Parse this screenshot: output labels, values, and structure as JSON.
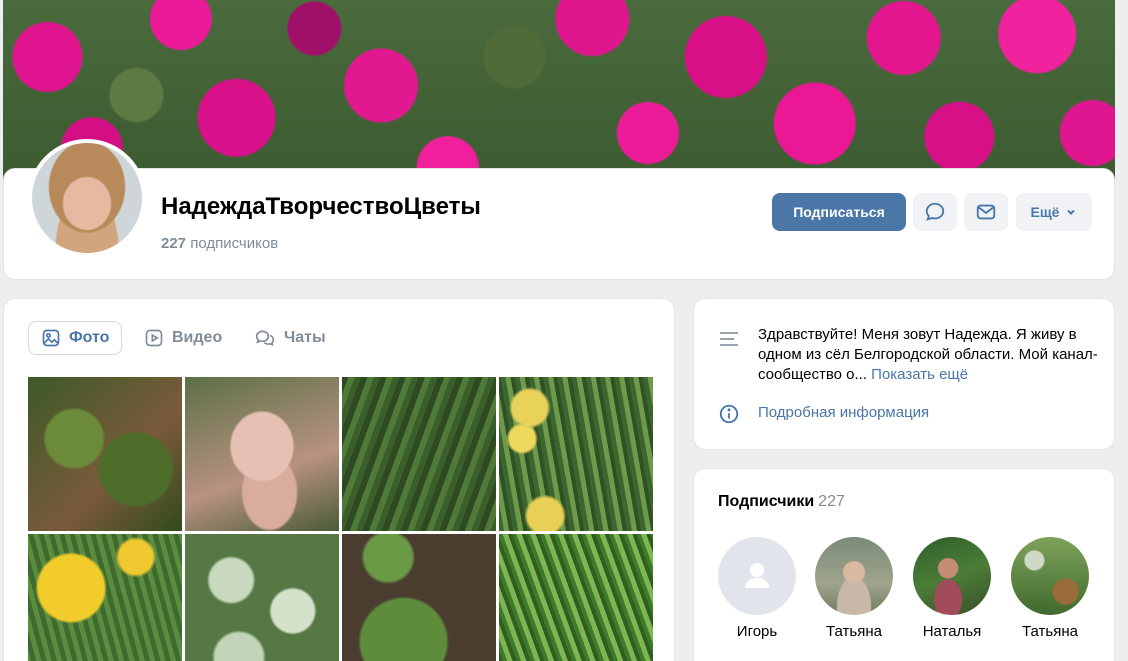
{
  "header": {
    "page_name": "НадеждаТворчествоЦветы",
    "subscribers_count": "227",
    "subscribers_label": "подписчиков",
    "subscribe_button": "Подписаться",
    "more_button": "Ещё"
  },
  "tabs": [
    {
      "label": "Фото",
      "icon": "photo-icon",
      "active": true
    },
    {
      "label": "Видео",
      "icon": "video-icon",
      "active": false
    },
    {
      "label": "Чаты",
      "icon": "chat-icon",
      "active": false
    }
  ],
  "photos": [
    "plant-stake",
    "pink-iris",
    "grass-leaves",
    "yellow-daffodils",
    "yellow-daffodil",
    "variegated-leaves",
    "green-seedling",
    "green-grass"
  ],
  "about": {
    "text": "Здравствуйте! Меня зовут Надежда. Я живу в одном из сёл Белгородской области. Мой канал-сообщество о...",
    "show_more": "Показать ещё",
    "details_link": "Подробная информация"
  },
  "followers": {
    "title": "Подписчики",
    "count": "227",
    "items": [
      {
        "name": "Игорь"
      },
      {
        "name": "Татьяна"
      },
      {
        "name": "Наталья"
      },
      {
        "name": "Татьяна"
      }
    ]
  },
  "colors": {
    "accent": "#4a76a8",
    "background": "#edeef0",
    "muted": "#818c99"
  }
}
